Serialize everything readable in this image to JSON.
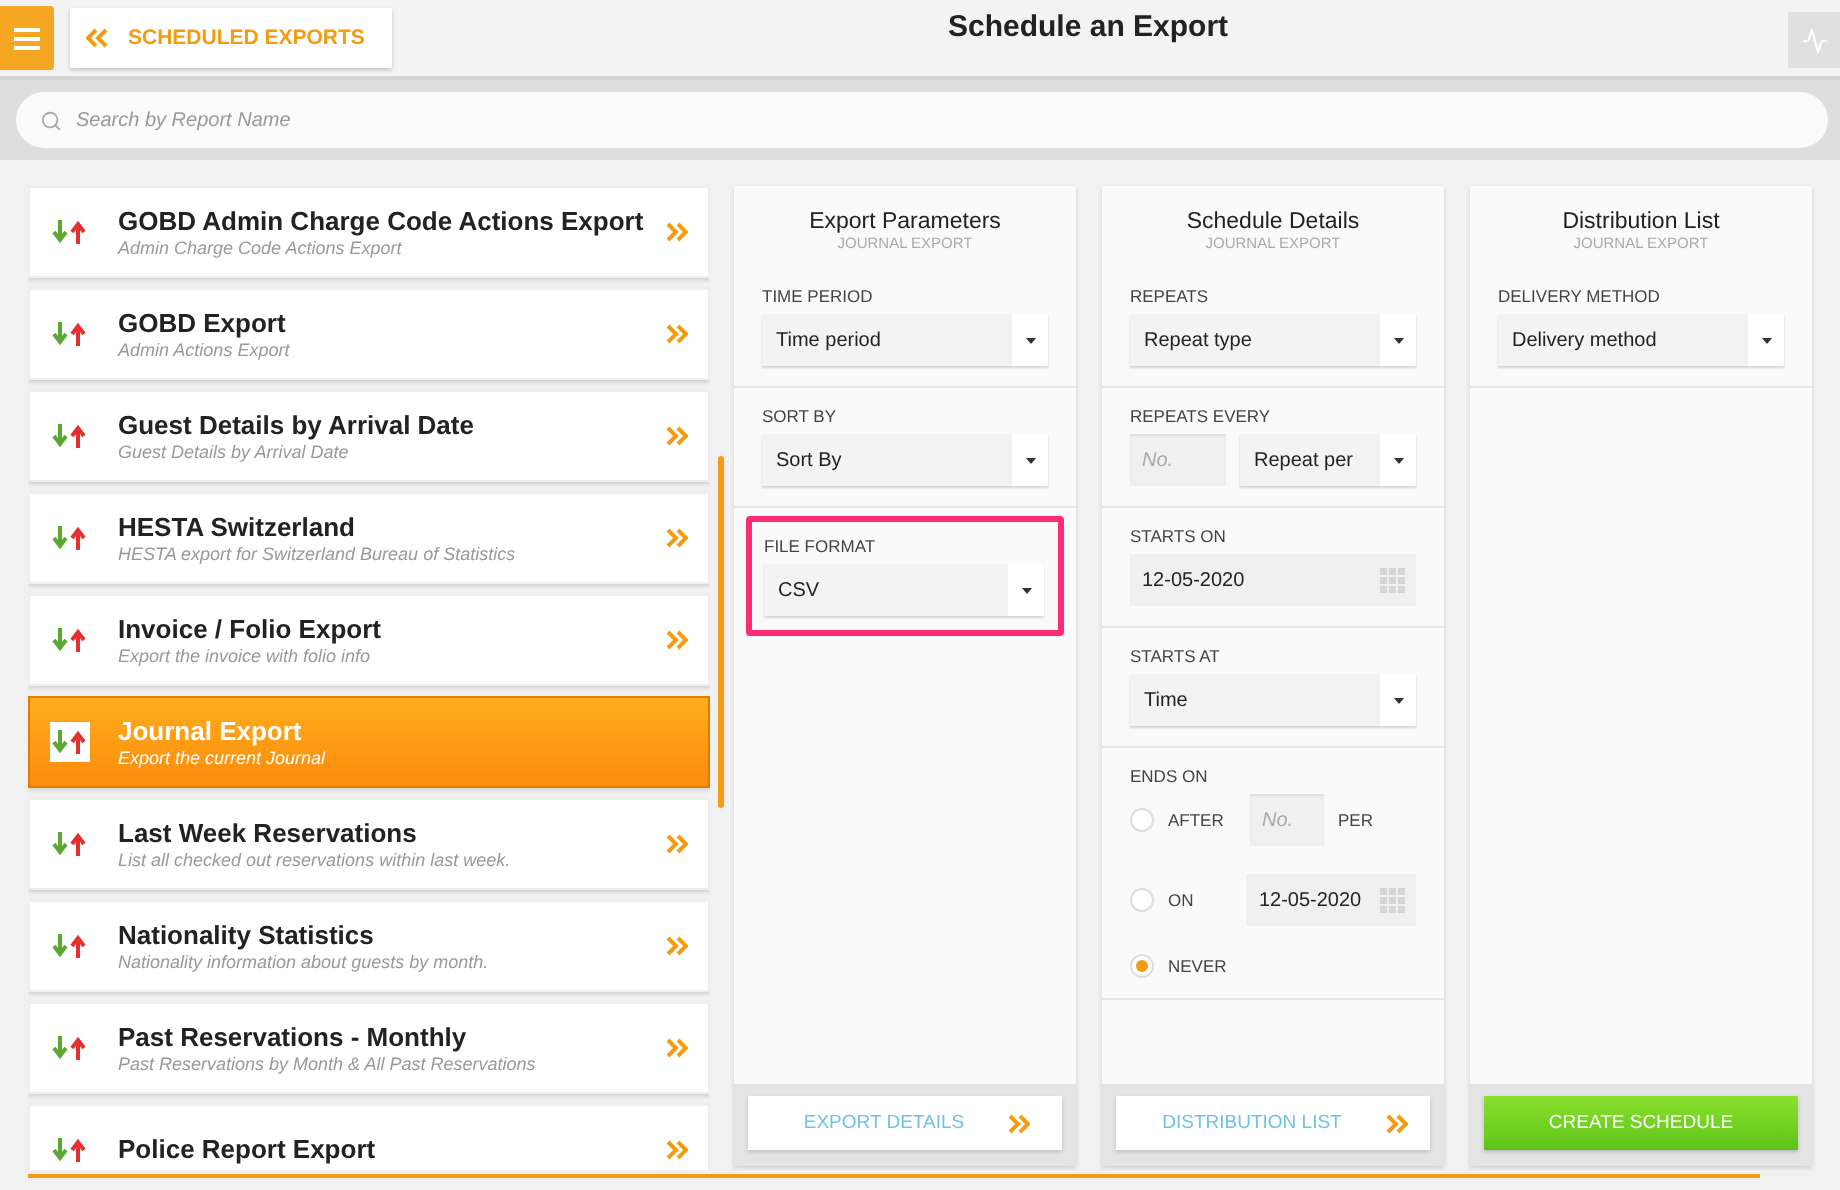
{
  "header": {
    "back_button": "SCHEDULED EXPORTS",
    "title": "Schedule an Export"
  },
  "search": {
    "placeholder": "Search by Report Name"
  },
  "reports": [
    {
      "title": "GOBD Admin Charge Code Actions Export",
      "subtitle": "Admin Charge Code Actions Export",
      "selected": false
    },
    {
      "title": "GOBD Export",
      "subtitle": "Admin Actions Export",
      "selected": false
    },
    {
      "title": "Guest Details by Arrival Date",
      "subtitle": "Guest Details by Arrival Date",
      "selected": false
    },
    {
      "title": "HESTA Switzerland",
      "subtitle": "HESTA export for Switzerland Bureau of Statistics",
      "selected": false
    },
    {
      "title": "Invoice / Folio Export",
      "subtitle": "Export the invoice with folio info",
      "selected": false
    },
    {
      "title": "Journal Export",
      "subtitle": "Export the current Journal",
      "selected": true
    },
    {
      "title": "Last Week Reservations",
      "subtitle": "List all checked out reservations within last week.",
      "selected": false
    },
    {
      "title": "Nationality Statistics",
      "subtitle": "Nationality information about guests by month.",
      "selected": false
    },
    {
      "title": "Past Reservations - Monthly",
      "subtitle": "Past Reservations by Month & All Past Reservations",
      "selected": false
    },
    {
      "title": "Police Report Export",
      "selected": false
    }
  ],
  "panels": [
    {
      "title": "Export Parameters",
      "subtitle": "JOURNAL EXPORT",
      "fields": [
        {
          "kind": "select",
          "label": "TIME PERIOD",
          "value": "Time period",
          "highlighted": false
        },
        {
          "kind": "select",
          "label": "SORT BY",
          "value": "Sort By",
          "highlighted": false
        },
        {
          "kind": "select",
          "label": "FILE FORMAT",
          "value": "CSV",
          "highlighted": true
        }
      ],
      "footer": {
        "kind": "link",
        "label": "EXPORT DETAILS"
      }
    },
    {
      "title": "Schedule Details",
      "subtitle": "JOURNAL EXPORT",
      "fields": [
        {
          "kind": "select",
          "label": "REPEATS",
          "value": "Repeat type",
          "highlighted": false
        },
        {
          "kind": "number_select",
          "label": "REPEATS EVERY",
          "placeholder": "No.",
          "value": "Repeat per",
          "highlighted": false
        },
        {
          "kind": "date",
          "label": "STARTS ON",
          "value": "12-05-2020",
          "highlighted": false
        },
        {
          "kind": "select",
          "label": "STARTS AT",
          "value": "Time",
          "highlighted": false
        },
        {
          "kind": "ends",
          "label": "ENDS ON",
          "highlighted": false,
          "options": [
            {
              "kind": "count",
              "label": "AFTER",
              "placeholder": "No.",
              "suffix": "PER",
              "selected": false
            },
            {
              "kind": "date",
              "label": "ON",
              "value": "12-05-2020",
              "selected": false
            },
            {
              "kind": "plain",
              "label": "NEVER",
              "selected": true
            }
          ]
        }
      ],
      "footer": {
        "kind": "link",
        "label": "DISTRIBUTION LIST"
      }
    },
    {
      "title": "Distribution List",
      "subtitle": "JOURNAL EXPORT",
      "fields": [
        {
          "kind": "select",
          "label": "DELIVERY METHOD",
          "value": "Delivery method",
          "highlighted": false
        }
      ],
      "footer": {
        "kind": "primary",
        "label": "CREATE SCHEDULE"
      }
    }
  ]
}
